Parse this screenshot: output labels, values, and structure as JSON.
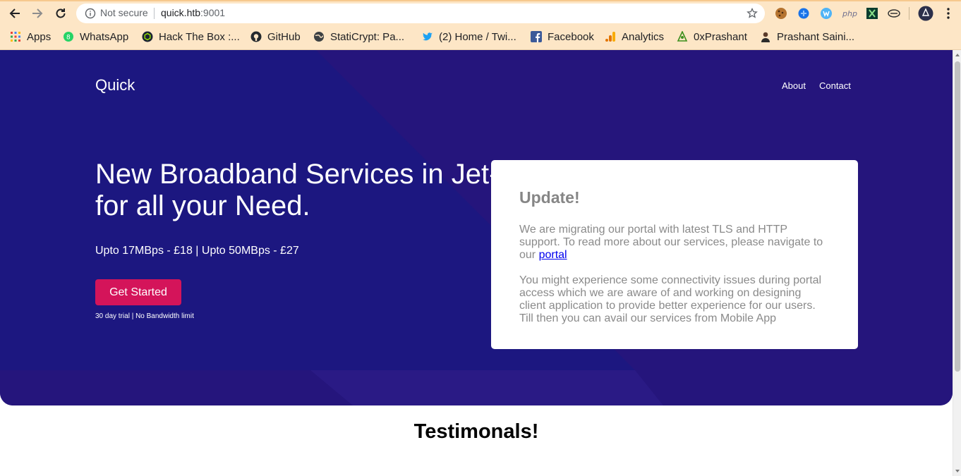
{
  "browser": {
    "security_label": "Not secure",
    "url_host": "quick.htb",
    "url_port": ":9001",
    "bookmarks": [
      {
        "label": "Apps",
        "icon": "apps-grid-icon"
      },
      {
        "label": "WhatsApp",
        "icon": "whatsapp-icon"
      },
      {
        "label": "Hack The Box :...",
        "icon": "hackthebox-icon"
      },
      {
        "label": "GitHub",
        "icon": "github-icon"
      },
      {
        "label": "StatiCrypt: Pa...",
        "icon": "globe-icon"
      },
      {
        "label": "(2) Home / Twi...",
        "icon": "twitter-icon"
      },
      {
        "label": "Facebook",
        "icon": "facebook-icon"
      },
      {
        "label": "Analytics",
        "icon": "analytics-icon"
      },
      {
        "label": "0xPrashant",
        "icon": "0xprashant-icon"
      },
      {
        "label": "Prashant Saini...",
        "icon": "avatar-icon"
      }
    ],
    "extensions": [
      "cookie-icon",
      "puzzle-ext-icon",
      "wappalyzer-icon",
      "php-icon",
      "xpath-icon",
      "link-ext-icon"
    ],
    "accent": "#fde6c6"
  },
  "site": {
    "brand": "Quick",
    "nav": {
      "about": "About",
      "contact": "Contact"
    },
    "headline_line1": "New Broadband Services in Jet-Tube",
    "headline_line2": "for all your Need.",
    "price": "Upto 17MBps - £18 | Upto 50MBps - £27",
    "cta": "Get Started",
    "trial": "30 day trial | No Bandwidth limit",
    "update": {
      "title": "Update!",
      "p1_text": "We are migrating our portal with latest TLS and HTTP support. To read more about our services, please navigate to our ",
      "p1_link": "portal",
      "p2": "You might experience some connectivity issues during portal access which we are aware of and working on designing client application to provide better experience for our users. Till then you can avail our services from Mobile App"
    },
    "testimonials_heading": "Testimonals!",
    "colors": {
      "hero": "#25157c",
      "hero_light": "#2a1a85",
      "cta": "#d4145a"
    }
  }
}
